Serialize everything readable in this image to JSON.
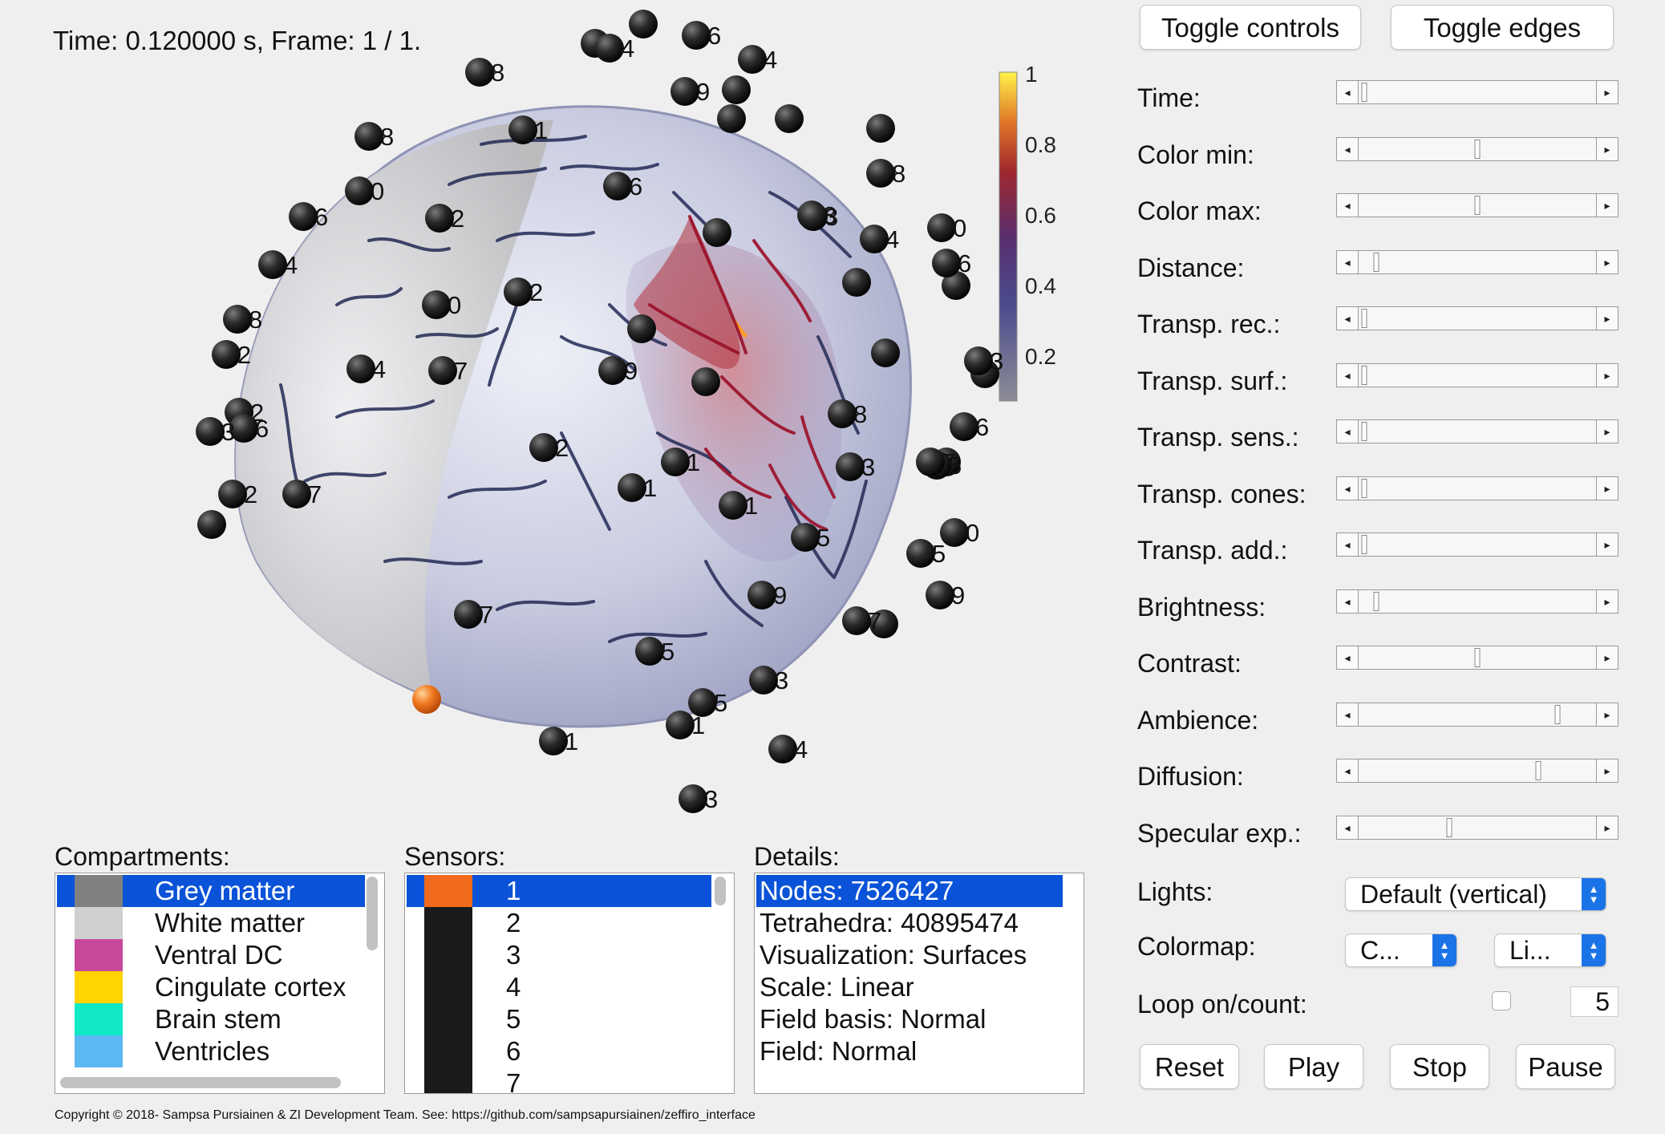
{
  "status_line": "Time: 0.120000 s, Frame: 1 / 1.",
  "colorbar": {
    "ticks": [
      "1",
      "0.8",
      "0.6",
      "0.4",
      "0.2"
    ]
  },
  "sensor_labels": [
    "4",
    "6",
    "4",
    "8",
    "8",
    "6",
    "8",
    "9",
    "4",
    "1",
    "0",
    "2",
    "8",
    "4",
    "0",
    "6",
    "0",
    "6",
    "2",
    "8",
    "3",
    "3",
    "4",
    "2",
    "7",
    "2",
    "6",
    "3",
    "2",
    "1",
    "7",
    "1",
    "8",
    "2",
    "1",
    "9",
    "6",
    "5",
    "7",
    "0",
    "5",
    "5",
    "7",
    "5",
    "9",
    "9",
    "7",
    "3",
    "5",
    "3",
    "1",
    "1",
    "4",
    "3"
  ],
  "buttons": {
    "toggle_controls": "Toggle controls",
    "toggle_edges": "Toggle edges",
    "reset": "Reset",
    "play": "Play",
    "stop": "Stop",
    "pause": "Pause"
  },
  "sliders": [
    {
      "label": "Time:",
      "value": 0.02
    },
    {
      "label": "Color min:",
      "value": 0.5
    },
    {
      "label": "Color max:",
      "value": 0.5
    },
    {
      "label": "Distance:",
      "value": 0.07
    },
    {
      "label": "Transp. rec.:",
      "value": 0.02
    },
    {
      "label": "Transp. surf.:",
      "value": 0.02
    },
    {
      "label": "Transp. sens.:",
      "value": 0.02
    },
    {
      "label": "Transp. cones:",
      "value": 0.02
    },
    {
      "label": "Transp. add.:",
      "value": 0.02
    },
    {
      "label": "Brightness:",
      "value": 0.07
    },
    {
      "label": "Contrast:",
      "value": 0.5
    },
    {
      "label": "Ambience:",
      "value": 0.84
    },
    {
      "label": "Diffusion:",
      "value": 0.76
    },
    {
      "label": "Specular exp.:",
      "value": 0.38
    }
  ],
  "lights": {
    "label": "Lights:",
    "value": "Default (vertical)"
  },
  "colormap": {
    "label": "Colormap:",
    "value1": "C...",
    "value2": "Li..."
  },
  "loop": {
    "label": "Loop on/count:",
    "count": "5"
  },
  "compartments": {
    "title": "Compartments:",
    "items": [
      {
        "name": "Grey matter",
        "color": "#808080",
        "selected": true
      },
      {
        "name": "White matter",
        "color": "#d0d0d0",
        "selected": false
      },
      {
        "name": "Ventral DC",
        "color": "#c8489c",
        "selected": false
      },
      {
        "name": "Cingulate cortex",
        "color": "#ffd400",
        "selected": false
      },
      {
        "name": "Brain stem",
        "color": "#10e8c8",
        "selected": false
      },
      {
        "name": "Ventricles",
        "color": "#5cb8f0",
        "selected": false
      }
    ]
  },
  "sensors": {
    "title": "Sensors:",
    "items": [
      {
        "name": "1",
        "color": "#f26a1b",
        "selected": true
      },
      {
        "name": "2",
        "color": "#1a1a1a",
        "selected": false
      },
      {
        "name": "3",
        "color": "#1a1a1a",
        "selected": false
      },
      {
        "name": "4",
        "color": "#1a1a1a",
        "selected": false
      },
      {
        "name": "5",
        "color": "#1a1a1a",
        "selected": false
      },
      {
        "name": "6",
        "color": "#1a1a1a",
        "selected": false
      },
      {
        "name": "7",
        "color": "#1a1a1a",
        "selected": false
      }
    ]
  },
  "details": {
    "title": "Details:",
    "items": [
      "Nodes: 7526427",
      "Tetrahedra: 40895474",
      "Visualization: Surfaces",
      "Scale: Linear",
      "Field basis: Normal",
      "Field: Normal"
    ]
  },
  "copyright": "Copyright © 2018- Sampsa Pursiainen & ZI Development Team. See: https://github.com/sampsapursiainen/zeffiro_interface"
}
